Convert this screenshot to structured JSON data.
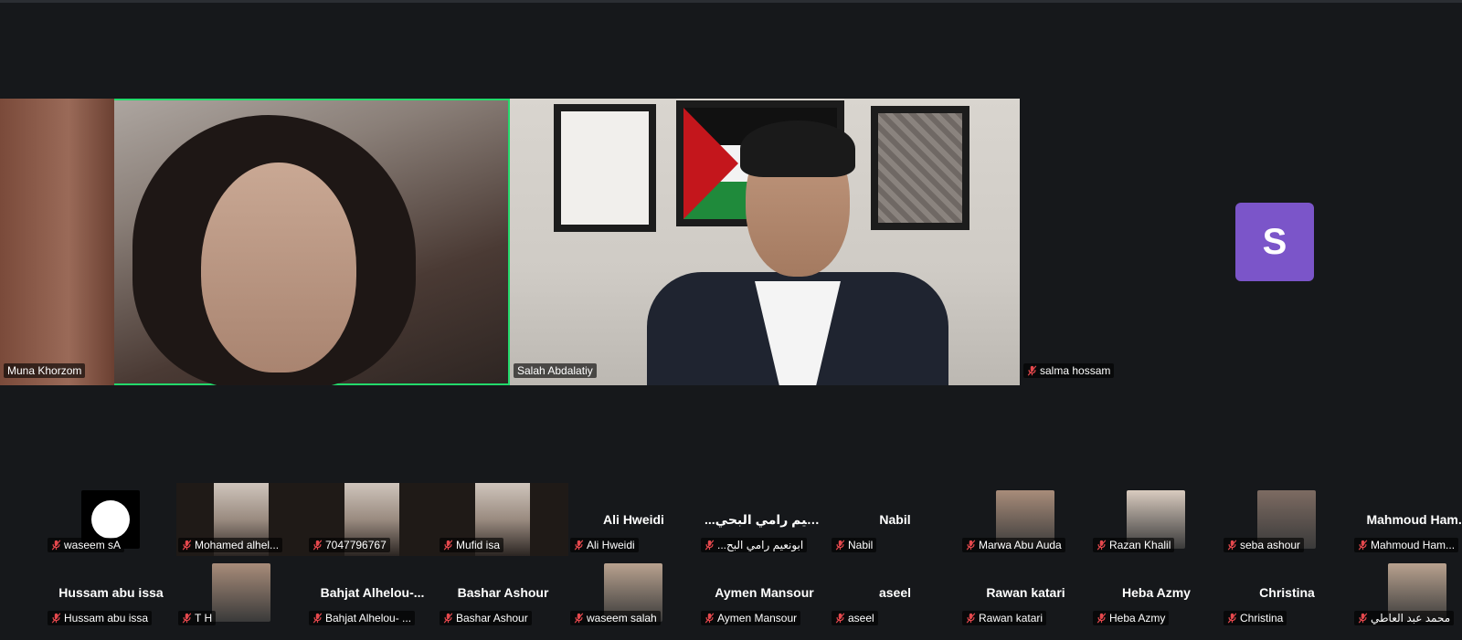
{
  "main_speakers": [
    {
      "name": "Muna Khorzom",
      "active": true
    },
    {
      "name": "Salah Abdalatiy",
      "active": false
    },
    {
      "name": "salma hossam",
      "avatar_letter": "S",
      "muted": true
    }
  ],
  "gallery_row1": [
    {
      "display_name": "",
      "label": "waseem sA",
      "muted": true,
      "kind": "avatar-circle"
    },
    {
      "display_name": "",
      "label": "Mohamed alhel...",
      "muted": true,
      "kind": "video"
    },
    {
      "display_name": "",
      "label": "7047796767",
      "muted": true,
      "kind": "video"
    },
    {
      "display_name": "",
      "label": "Mufid isa",
      "muted": true,
      "kind": "video"
    },
    {
      "display_name": "Ali Hweidi",
      "label": "Ali Hweidi",
      "muted": true,
      "kind": "name"
    },
    {
      "display_name": "...ابونعيم رامي البحي",
      "label": "...ابونعيم رامي البح",
      "muted": true,
      "kind": "name"
    },
    {
      "display_name": "Nabil",
      "label": "Nabil",
      "muted": true,
      "kind": "name"
    },
    {
      "display_name": "",
      "label": "Marwa Abu Auda",
      "muted": true,
      "kind": "photo"
    },
    {
      "display_name": "",
      "label": "Razan Khalil",
      "muted": true,
      "kind": "photo"
    },
    {
      "display_name": "",
      "label": "seba ashour",
      "muted": true,
      "kind": "photo"
    },
    {
      "display_name": "Mahmoud  Ham...",
      "label": "Mahmoud Ham...",
      "muted": true,
      "kind": "name"
    }
  ],
  "gallery_row2": [
    {
      "display_name": "Hussam abu issa",
      "label": "Hussam abu issa",
      "muted": true,
      "kind": "name"
    },
    {
      "display_name": "",
      "label": "T H",
      "muted": true,
      "kind": "photo"
    },
    {
      "display_name": "Bahjat  Alhelou-...",
      "label": "Bahjat Alhelou- ...",
      "muted": true,
      "kind": "name"
    },
    {
      "display_name": "Bashar Ashour",
      "label": "Bashar Ashour",
      "muted": true,
      "kind": "name"
    },
    {
      "display_name": "",
      "label": "waseem salah",
      "muted": true,
      "kind": "photo"
    },
    {
      "display_name": "Aymen Mansour",
      "label": "Aymen Mansour",
      "muted": true,
      "kind": "name"
    },
    {
      "display_name": "aseel",
      "label": "aseel",
      "muted": true,
      "kind": "name"
    },
    {
      "display_name": "Rawan katari",
      "label": "Rawan katari",
      "muted": true,
      "kind": "name"
    },
    {
      "display_name": "Heba Azmy",
      "label": "Heba Azmy",
      "muted": true,
      "kind": "name"
    },
    {
      "display_name": "Christina",
      "label": "Christina",
      "muted": true,
      "kind": "name"
    },
    {
      "display_name": "",
      "label": "محمد عبد العاطي",
      "muted": true,
      "kind": "photo"
    }
  ],
  "colors": {
    "active_border": "#23d96b",
    "avatar_bg": "#7b55c9",
    "mute_icon": "#e5484d",
    "background": "#16181b"
  }
}
